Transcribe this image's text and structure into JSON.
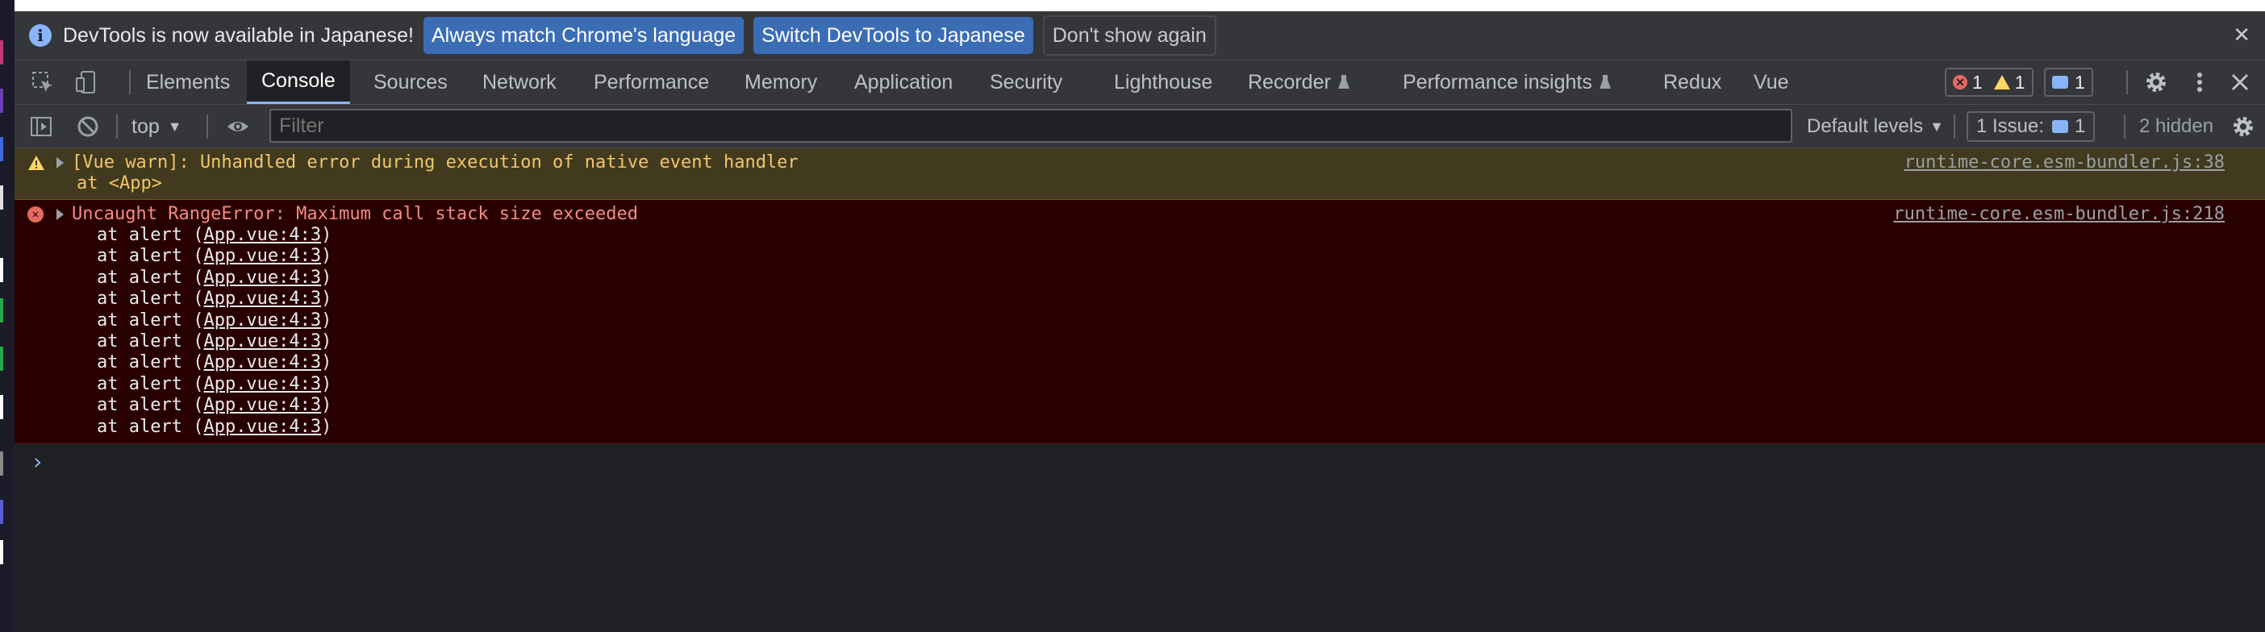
{
  "infobar": {
    "message": "DevTools is now available in Japanese!",
    "buttons": [
      "Always match Chrome's language",
      "Switch DevTools to Japanese",
      "Don't show again"
    ],
    "close": "✕"
  },
  "tabs": [
    "Elements",
    "Console",
    "Sources",
    "Network",
    "Performance",
    "Memory",
    "Application",
    "Security",
    "Lighthouse",
    "Recorder",
    "Performance insights",
    "Redux",
    "Vue"
  ],
  "active_tab": "Console",
  "counters": {
    "errors": "1",
    "warnings": "1",
    "messages": "1"
  },
  "console_toolbar": {
    "context": "top",
    "filter_placeholder": "Filter",
    "levels": "Default levels",
    "issues_label": "1 Issue:",
    "issues_count": "1",
    "hidden": "2 hidden"
  },
  "warning": {
    "text": "[Vue warn]: Unhandled error during execution of native event handler",
    "subline": "at <App>",
    "source": "runtime-core.esm-bundler.js:38"
  },
  "error": {
    "text": "Uncaught RangeError: Maximum call stack size exceeded",
    "source": "runtime-core.esm-bundler.js:218",
    "frame_prefix": "at alert (",
    "frame_link": "App.vue:4:3",
    "frame_suffix": ")",
    "frame_count": 10
  },
  "prompt": "›",
  "colors": {
    "accent": "#8ab4f8",
    "warning": "#f2c56a",
    "error": "#f28b82",
    "bg": "#202124"
  }
}
